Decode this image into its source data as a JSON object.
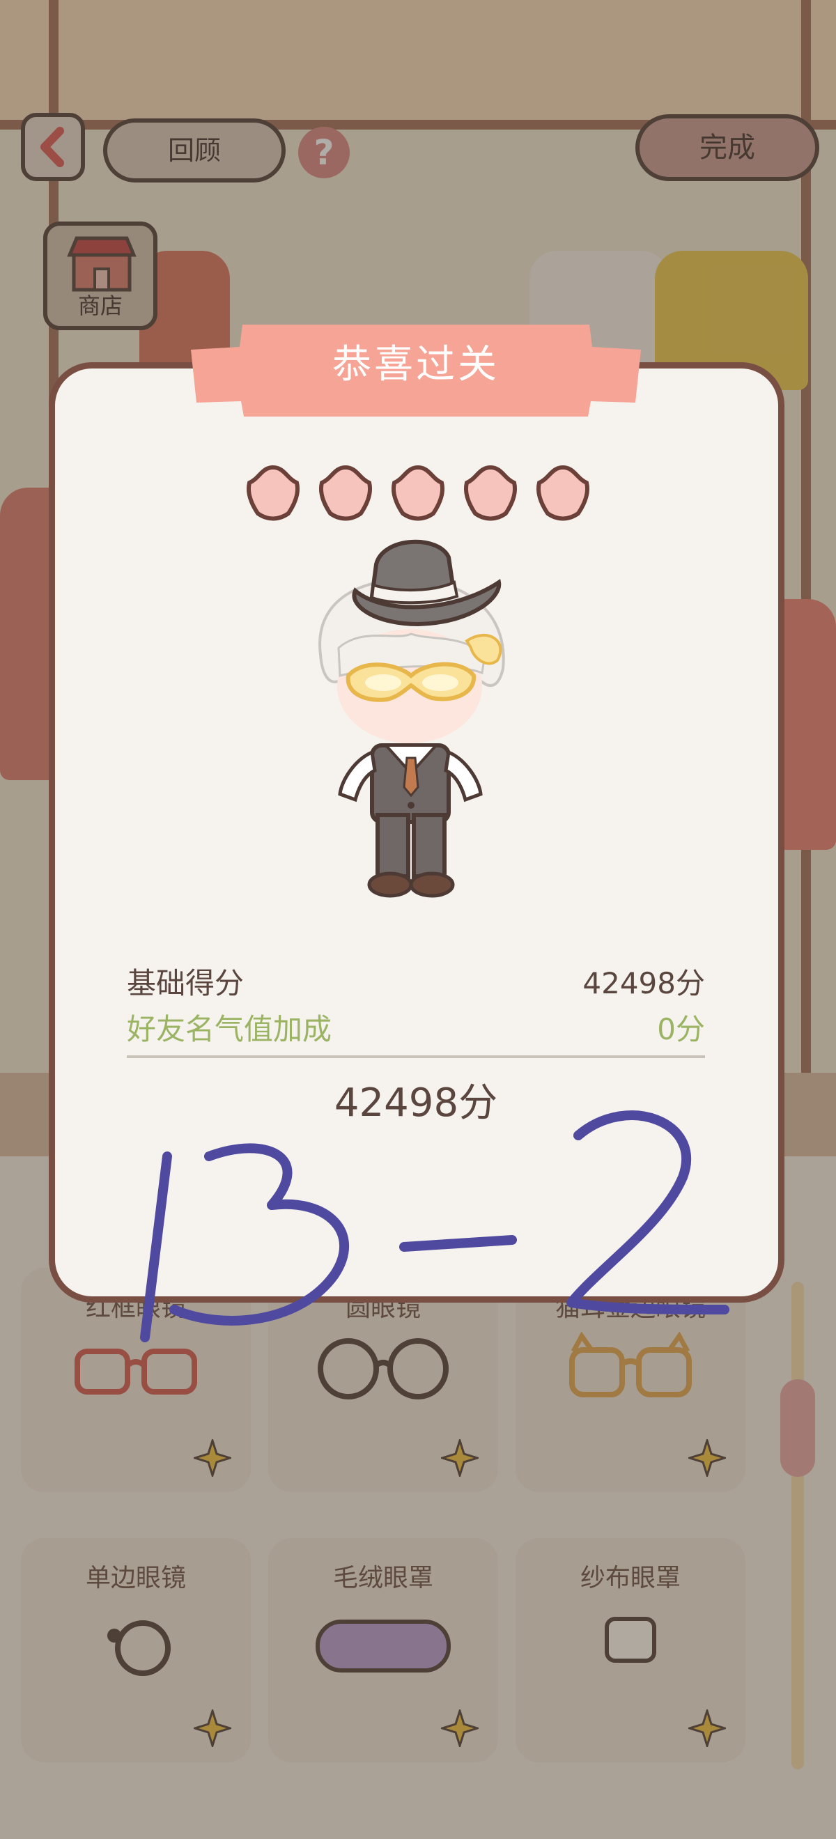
{
  "top_bar": {
    "review_label": "回顾",
    "help_symbol": "?",
    "done_label": "完成",
    "shop_label": "商店"
  },
  "wardrobe": {
    "items": [
      {
        "name": "红框眼镜"
      },
      {
        "name": "圆眼镜"
      },
      {
        "name": "猫耳金边眼镜"
      },
      {
        "name": "单边眼镜"
      },
      {
        "name": "毛绒眼罩"
      },
      {
        "name": "纱布眼罩"
      }
    ]
  },
  "result": {
    "title": "恭喜过关",
    "stars": 5,
    "base_score_label": "基础得分",
    "base_score_value": "42498分",
    "bonus_label": "好友名气值加成",
    "bonus_value": "0分",
    "total": "42498分"
  },
  "annotation": {
    "text": "13-2"
  },
  "colors": {
    "ribbon": "#f6a496",
    "star_fill": "#f7c3bd",
    "outline": "#7a4f43",
    "bonus_text": "#9ab463",
    "ink": "#4f4aa0"
  }
}
